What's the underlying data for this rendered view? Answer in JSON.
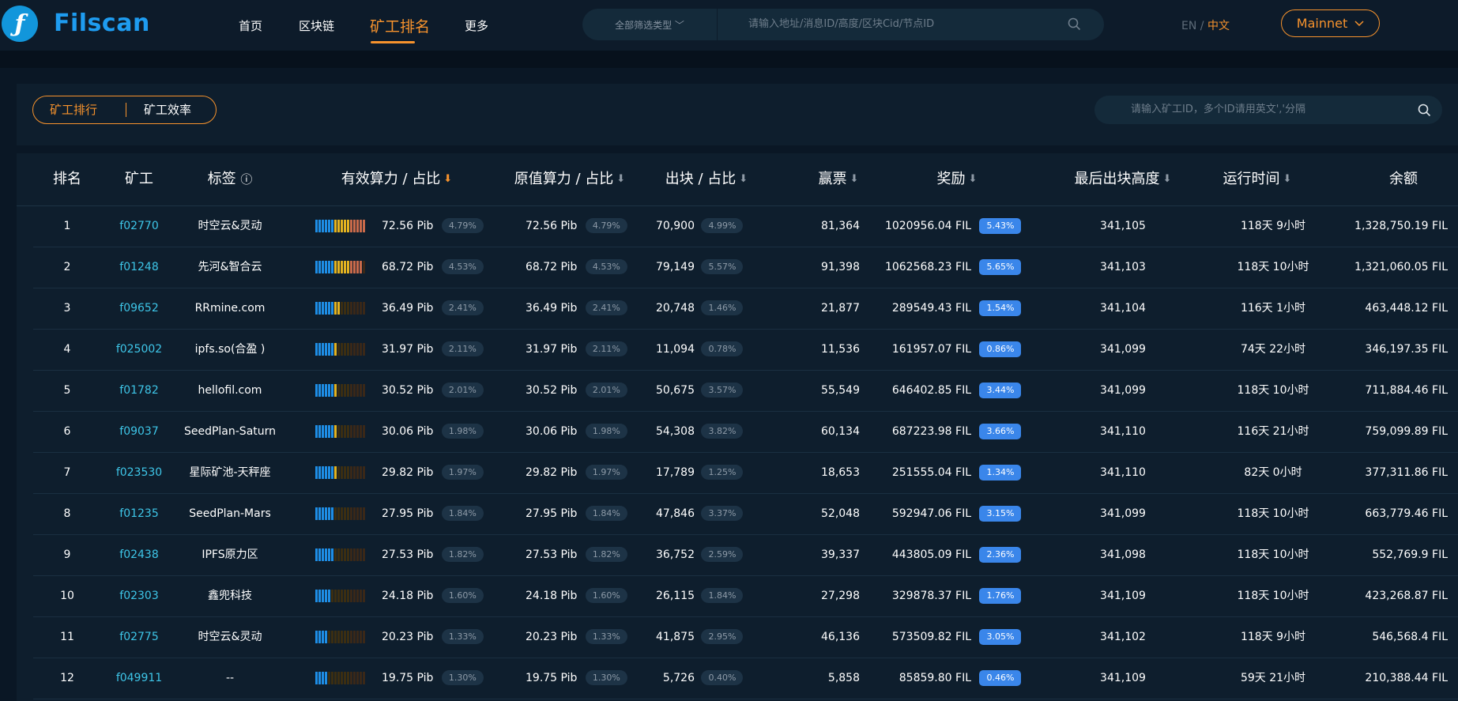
{
  "header": {
    "brand": "Filscan",
    "logo_char": "ƒ",
    "nav": [
      "首页",
      "区块链",
      "矿工排名",
      "更多"
    ],
    "filter_label": "全部筛选类型 ﹀",
    "search_placeholder": "请输入地址/消息ID/高度/区块Cid/节点ID",
    "lang_en": "EN",
    "lang_sep": "/",
    "lang_zh": "中文",
    "network": "Mainnet"
  },
  "panel": {
    "tabs": [
      "矿工排行",
      "矿工效率"
    ],
    "search_placeholder": "请输入矿工ID，多个ID请用英文','分隔"
  },
  "table": {
    "headers": [
      "排名",
      "矿工",
      "标签",
      "有效算力 / 占比",
      "原值算力 / 占比",
      "出块 / 占比",
      "赢票",
      "奖励",
      "最后出块高度",
      "运行时间",
      "余额"
    ],
    "label_info_icon": "ⓘ",
    "sort_arrow": "⬇",
    "rows": [
      {
        "rank": "1",
        "miner": "f02770",
        "tag": "时空云&灵动",
        "eff_power": "72.56 Pib",
        "eff_pct": "4.79%",
        "raw_power": "72.56 Pib",
        "raw_pct": "4.79%",
        "blocks": "70,900",
        "blocks_pct": "4.99%",
        "wins": "81,364",
        "reward": "1020956.04 FIL",
        "reward_pct": "5.43%",
        "last_height": "341,105",
        "runtime": "118天 9小时",
        "balance": "1,328,750.19 FIL"
      },
      {
        "rank": "2",
        "miner": "f01248",
        "tag": "先河&智合云",
        "eff_power": "68.72 Pib",
        "eff_pct": "4.53%",
        "raw_power": "68.72 Pib",
        "raw_pct": "4.53%",
        "blocks": "79,149",
        "blocks_pct": "5.57%",
        "wins": "91,398",
        "reward": "1062568.23 FIL",
        "reward_pct": "5.65%",
        "last_height": "341,103",
        "runtime": "118天 10小时",
        "balance": "1,321,060.05 FIL"
      },
      {
        "rank": "3",
        "miner": "f09652",
        "tag": "RRmine.com",
        "eff_power": "36.49 Pib",
        "eff_pct": "2.41%",
        "raw_power": "36.49 Pib",
        "raw_pct": "2.41%",
        "blocks": "20,748",
        "blocks_pct": "1.46%",
        "wins": "21,877",
        "reward": "289549.43 FIL",
        "reward_pct": "1.54%",
        "last_height": "341,104",
        "runtime": "116天 1小时",
        "balance": "463,448.12 FIL"
      },
      {
        "rank": "4",
        "miner": "f025002",
        "tag": "ipfs.so(合盈 )",
        "eff_power": "31.97 Pib",
        "eff_pct": "2.11%",
        "raw_power": "31.97 Pib",
        "raw_pct": "2.11%",
        "blocks": "11,094",
        "blocks_pct": "0.78%",
        "wins": "11,536",
        "reward": "161957.07 FIL",
        "reward_pct": "0.86%",
        "last_height": "341,099",
        "runtime": "74天 22小时",
        "balance": "346,197.35 FIL"
      },
      {
        "rank": "5",
        "miner": "f01782",
        "tag": "hellofil.com",
        "eff_power": "30.52 Pib",
        "eff_pct": "2.01%",
        "raw_power": "30.52 Pib",
        "raw_pct": "2.01%",
        "blocks": "50,675",
        "blocks_pct": "3.57%",
        "wins": "55,549",
        "reward": "646402.85 FIL",
        "reward_pct": "3.44%",
        "last_height": "341,099",
        "runtime": "118天 10小时",
        "balance": "711,884.46 FIL"
      },
      {
        "rank": "6",
        "miner": "f09037",
        "tag": "SeedPlan-Saturn",
        "eff_power": "30.06 Pib",
        "eff_pct": "1.98%",
        "raw_power": "30.06 Pib",
        "raw_pct": "1.98%",
        "blocks": "54,308",
        "blocks_pct": "3.82%",
        "wins": "60,134",
        "reward": "687223.98 FIL",
        "reward_pct": "3.66%",
        "last_height": "341,110",
        "runtime": "116天 21小时",
        "balance": "759,099.89 FIL"
      },
      {
        "rank": "7",
        "miner": "f023530",
        "tag": "星际矿池-天秤座",
        "eff_power": "29.82 Pib",
        "eff_pct": "1.97%",
        "raw_power": "29.82 Pib",
        "raw_pct": "1.97%",
        "blocks": "17,789",
        "blocks_pct": "1.25%",
        "wins": "18,653",
        "reward": "251555.04 FIL",
        "reward_pct": "1.34%",
        "last_height": "341,110",
        "runtime": "82天 0小时",
        "balance": "377,311.86 FIL"
      },
      {
        "rank": "8",
        "miner": "f01235",
        "tag": "SeedPlan-Mars",
        "eff_power": "27.95 Pib",
        "eff_pct": "1.84%",
        "raw_power": "27.95 Pib",
        "raw_pct": "1.84%",
        "blocks": "47,846",
        "blocks_pct": "3.37%",
        "wins": "52,048",
        "reward": "592947.06 FIL",
        "reward_pct": "3.15%",
        "last_height": "341,099",
        "runtime": "118天 10小时",
        "balance": "663,779.46 FIL"
      },
      {
        "rank": "9",
        "miner": "f02438",
        "tag": "IPFS原力区",
        "eff_power": "27.53 Pib",
        "eff_pct": "1.82%",
        "raw_power": "27.53 Pib",
        "raw_pct": "1.82%",
        "blocks": "36,752",
        "blocks_pct": "2.59%",
        "wins": "39,337",
        "reward": "443805.09 FIL",
        "reward_pct": "2.36%",
        "last_height": "341,098",
        "runtime": "118天 10小时",
        "balance": "552,769.9 FIL"
      },
      {
        "rank": "10",
        "miner": "f02303",
        "tag": "鑫兜科技",
        "eff_power": "24.18 Pib",
        "eff_pct": "1.60%",
        "raw_power": "24.18 Pib",
        "raw_pct": "1.60%",
        "blocks": "26,115",
        "blocks_pct": "1.84%",
        "wins": "27,298",
        "reward": "329878.37 FIL",
        "reward_pct": "1.76%",
        "last_height": "341,109",
        "runtime": "118天 10小时",
        "balance": "423,268.87 FIL"
      },
      {
        "rank": "11",
        "miner": "f02775",
        "tag": "时空云&灵动",
        "eff_power": "20.23 Pib",
        "eff_pct": "1.33%",
        "raw_power": "20.23 Pib",
        "raw_pct": "1.33%",
        "blocks": "41,875",
        "blocks_pct": "2.95%",
        "wins": "46,136",
        "reward": "573509.82 FIL",
        "reward_pct": "3.05%",
        "last_height": "341,102",
        "runtime": "118天 9小时",
        "balance": "546,568.4 FIL"
      },
      {
        "rank": "12",
        "miner": "f049911",
        "tag": "--",
        "eff_power": "19.75 Pib",
        "eff_pct": "1.30%",
        "raw_power": "19.75 Pib",
        "raw_pct": "1.30%",
        "blocks": "5,726",
        "blocks_pct": "0.40%",
        "wins": "5,858",
        "reward": "85859.80 FIL",
        "reward_pct": "0.46%",
        "last_height": "341,109",
        "runtime": "59天 21小时",
        "balance": "210,388.44 FIL"
      }
    ]
  },
  "colors": {
    "accent": "#f7932d",
    "link": "#3ec6e8",
    "reward_pill": "#3a86ea",
    "bar_on_blue": "#1e8ee6",
    "bar_on_yellow": "#e3b320",
    "bar_on_red": "#c96a4a",
    "bar_off": "#3a2818"
  }
}
